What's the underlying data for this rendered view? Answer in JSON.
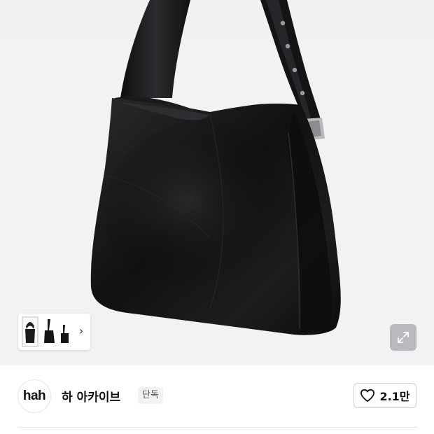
{
  "product_image": {
    "subject": "bag-photo"
  },
  "thumbnails": {
    "count": 3,
    "next_icon": "chevron-right-icon"
  },
  "expand": {
    "icon": "expand-arrows-icon"
  },
  "store": {
    "logo_text": "hah",
    "name": "하 아카이브",
    "badge": "단독"
  },
  "like": {
    "icon": "heart-outline-icon",
    "count": "2.1만"
  }
}
